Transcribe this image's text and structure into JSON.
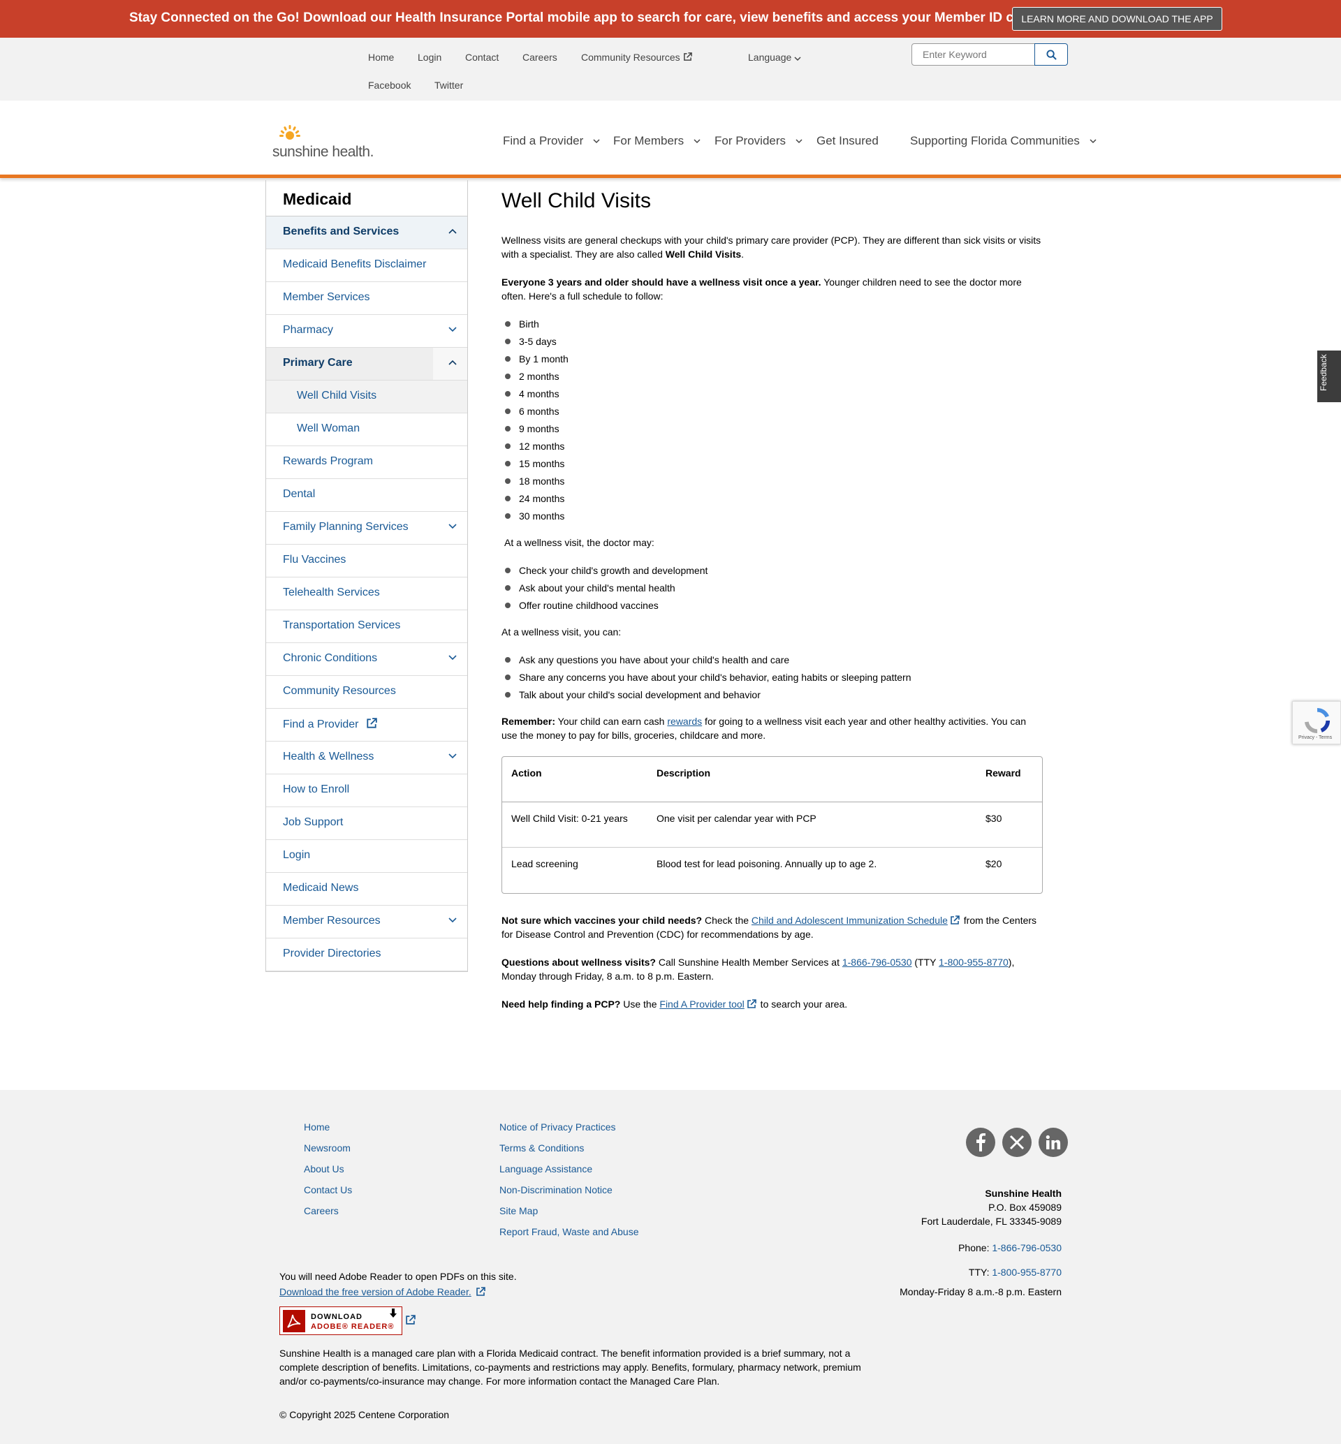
{
  "banner": {
    "text": "Stay Connected on the Go! Download our Health Insurance Portal mobile app to search for care, view benefits and access your Member ID card.",
    "button": "LEARN MORE AND DOWNLOAD THE APP"
  },
  "utility": {
    "links": [
      "Home",
      "Login",
      "Contact",
      "Careers",
      "Community Resources",
      "Language",
      "Facebook",
      "Twitter"
    ],
    "search_placeholder": "Enter Keyword"
  },
  "header": {
    "logo_text": "sunshine health.",
    "nav": [
      "Find a Provider",
      "For Members",
      "For Providers",
      "Get Insured",
      "Supporting Florida Communities"
    ]
  },
  "sidebar": {
    "title": "Medicaid",
    "items": [
      "Benefits and Services",
      "Medicaid Benefits Disclaimer",
      "Member Services",
      "Pharmacy",
      "Primary Care",
      "Well Child Visits",
      "Well Woman",
      "Rewards Program",
      "Dental",
      "Family Planning Services",
      "Flu Vaccines",
      "Telehealth Services",
      "Transportation Services",
      "Chronic Conditions",
      "Community Resources",
      "Find a Provider",
      "Health & Wellness",
      "How to Enroll",
      "Job Support",
      "Login",
      "Medicaid News",
      "Member Resources",
      "Provider Directories"
    ]
  },
  "content": {
    "title": "Well Child Visits",
    "intro": "Wellness visits are general checkups with your child's primary care provider (PCP). They are different than sick visits or visits with a specialist. They are also called ",
    "intro_bold": "Well Child Visits",
    "schedule_bold": "Everyone 3 years and older should have a wellness visit once a year.",
    "schedule_text": " Younger children need to see the doctor more often. Here's a full schedule to follow:",
    "schedule": [
      "Birth",
      "3-5 days",
      "By 1 month",
      "2 months",
      "4 months",
      "6 months",
      "9 months",
      "12 months",
      "15 months",
      "18 months",
      "24 months",
      "30 months"
    ],
    "doctor_intro": "At a wellness visit, the doctor may:",
    "doctor_items": [
      "Check your child's growth and development",
      "Ask about your child's mental health",
      "Offer routine childhood vaccines"
    ],
    "you_intro": "At a wellness visit, you can:",
    "you_items": [
      "Ask any questions you have about your child's health and care",
      "Share any concerns you have about your child's behavior, eating habits or sleeping pattern",
      "Talk about your child's social development and behavior"
    ],
    "remember_bold": "Remember:",
    "remember_a": " Your child can earn cash ",
    "remember_link": "rewards",
    "remember_b": " for going to a wellness visit each year and other healthy activities. You can use the money to pay for bills, groceries, childcare and more.",
    "table": {
      "headers": [
        "Action",
        "Description",
        "Reward"
      ],
      "rows": [
        [
          "Well Child Visit: 0-21 years",
          "One visit per calendar year with PCP",
          "$30"
        ],
        [
          "Lead screening",
          "Blood test for lead poisoning. Annually up to age 2.",
          "$20"
        ]
      ]
    },
    "vaccines_bold": "Not sure which vaccines your child needs?",
    "vaccines_a": " Check the ",
    "vaccines_link": "Child and Adolescent Immunization Schedule",
    "vaccines_b": " from the Centers for Disease Control and Prevention (CDC) for recommendations by age.",
    "questions_bold": "Questions about wellness visits?",
    "questions_a": " Call Sunshine Health Member Services at ",
    "questions_phone": "1-866-796-0530",
    "questions_b": " (TTY ",
    "questions_tty": "1-800-955-8770",
    "questions_c": "), Monday through Friday, 8 a.m. to 8 p.m. Eastern.",
    "pcp_bold": "Need help finding a PCP?",
    "pcp_a": " Use the ",
    "pcp_link": "Find A Provider tool",
    "pcp_b": " to search your area."
  },
  "widgets": {
    "feedback": "Feedback",
    "recaptcha": "Privacy - Terms"
  },
  "footer": {
    "col1": [
      "Home",
      "Newsroom",
      "About Us",
      "Contact Us",
      "Careers"
    ],
    "col2": [
      "Notice of Privacy Practices",
      "Terms & Conditions",
      "Language Assistance",
      "Non-Discrimination Notice",
      "Site Map",
      "Report Fraud, Waste and Abuse"
    ],
    "social": [
      "facebook-icon",
      "x-icon",
      "linkedin-icon"
    ],
    "org": "Sunshine Health",
    "address1": "P.O. Box 459089",
    "address2": "Fort Lauderdale, FL 33345-9089",
    "phone_label": "Phone: ",
    "phone": "1-866-796-0530",
    "tty_label": "TTY: ",
    "tty": "1-800-955-8770",
    "hours": "Monday-Friday 8 a.m.-8 p.m. Eastern",
    "adobe_note": "You will need Adobe Reader to open PDFs on this site.",
    "adobe_link": "Download the free version of Adobe Reader.",
    "adobe_badge_l1": "DOWNLOAD",
    "adobe_badge_l2": "ADOBE® READER®",
    "disclaimer": "Sunshine Health is a managed care plan with a Florida Medicaid contract. The benefit information provided is a brief summary, not a complete description of benefits. Limitations, co-payments and restrictions may apply. Benefits, formulary, pharmacy network, premium and/or co-payments/co-insurance may change. For more information contact the Managed Care Plan.",
    "copyright": "© Copyright 2025 Centene Corporation"
  },
  "colors": {
    "banner": "#c8402a",
    "accent": "#e87722",
    "link": "#1a5a96"
  }
}
